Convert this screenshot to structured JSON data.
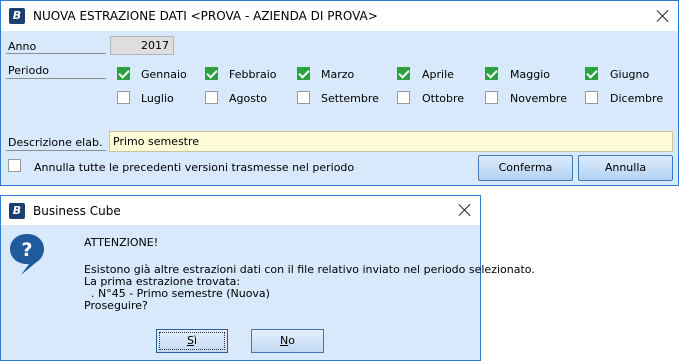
{
  "dialog1": {
    "title": "NUOVA ESTRAZIONE DATI <PROVA - AZIENDA DI PROVA>",
    "anno_label": "Anno",
    "anno_value": "2017",
    "periodo_label": "Periodo",
    "months": [
      {
        "label": "Gennaio",
        "checked": true
      },
      {
        "label": "Febbraio",
        "checked": true
      },
      {
        "label": "Marzo",
        "checked": true
      },
      {
        "label": "Aprile",
        "checked": true
      },
      {
        "label": "Maggio",
        "checked": true
      },
      {
        "label": "Giugno",
        "checked": true
      },
      {
        "label": "Luglio",
        "checked": false
      },
      {
        "label": "Agosto",
        "checked": false
      },
      {
        "label": "Settembre",
        "checked": false
      },
      {
        "label": "Ottobre",
        "checked": false
      },
      {
        "label": "Novembre",
        "checked": false
      },
      {
        "label": "Dicembre",
        "checked": false
      }
    ],
    "descrizione_label": "Descrizione elab.",
    "descrizione_value": "Primo semestre",
    "annulla_check_label": "Annulla tutte le precedenti versioni trasmesse nel periodo",
    "annulla_check_checked": false,
    "conferma_label": "Conferma",
    "annulla_label": "Annulla"
  },
  "dialog2": {
    "title": "Business Cube",
    "heading": "ATTENZIONE!",
    "message_lines": [
      "Esistono già altre estrazioni dati con il file relativo inviato nel periodo selezionato.",
      "La prima estrazione trovata:",
      "  . N°45 - Primo semestre (Nuova)",
      "Proseguire?"
    ],
    "yes_label": "Sì",
    "no_label": "No"
  },
  "icons": {
    "app": "business-cube-logo-icon",
    "close": "close-icon",
    "question": "question-icon"
  },
  "colors": {
    "accent": "#2b7bd1",
    "client_bg": "#d7e9fb",
    "checked_green": "#2ea043",
    "input_yellow": "#fffcd8",
    "question_blue": "#1e5a9c"
  }
}
